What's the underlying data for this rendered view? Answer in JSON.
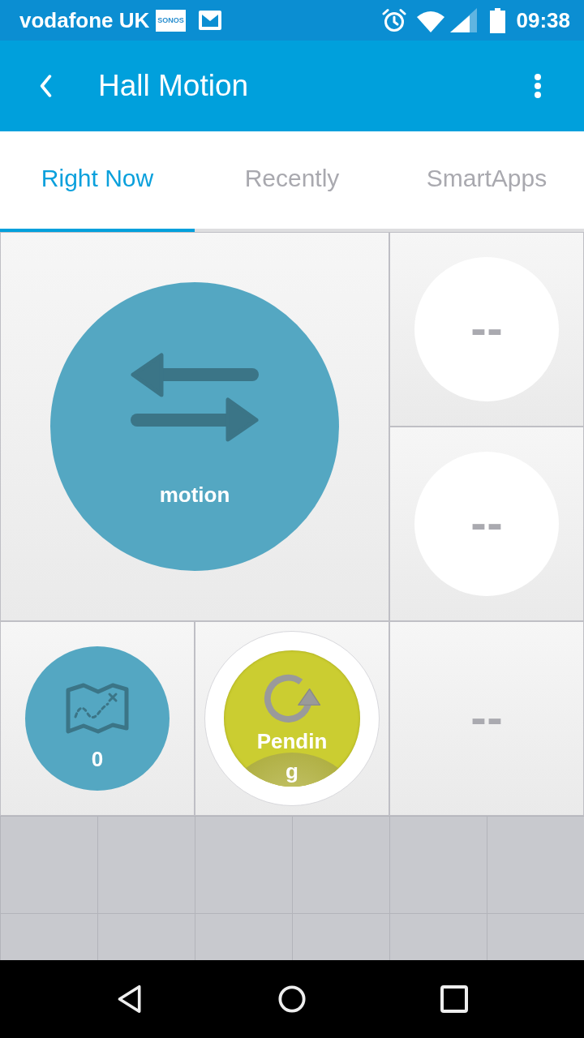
{
  "status_bar": {
    "carrier": "vodafone UK",
    "notifications": [
      {
        "kind": "app-badge",
        "label": "SONOS"
      },
      {
        "kind": "mail"
      }
    ],
    "time": "09:38"
  },
  "app_bar": {
    "title": "Hall Motion"
  },
  "tabs": [
    {
      "label": "Right Now",
      "selected": true
    },
    {
      "label": "Recently",
      "selected": false
    },
    {
      "label": "SmartApps",
      "selected": false
    }
  ],
  "tiles": [
    {
      "kind": "motion",
      "label": "motion"
    },
    {
      "kind": "empty-circle",
      "value": "--"
    },
    {
      "kind": "empty-circle",
      "value": "--"
    },
    {
      "kind": "counter",
      "value": "0"
    },
    {
      "kind": "status",
      "label": "Pending"
    },
    {
      "kind": "empty",
      "value": "--"
    }
  ]
}
